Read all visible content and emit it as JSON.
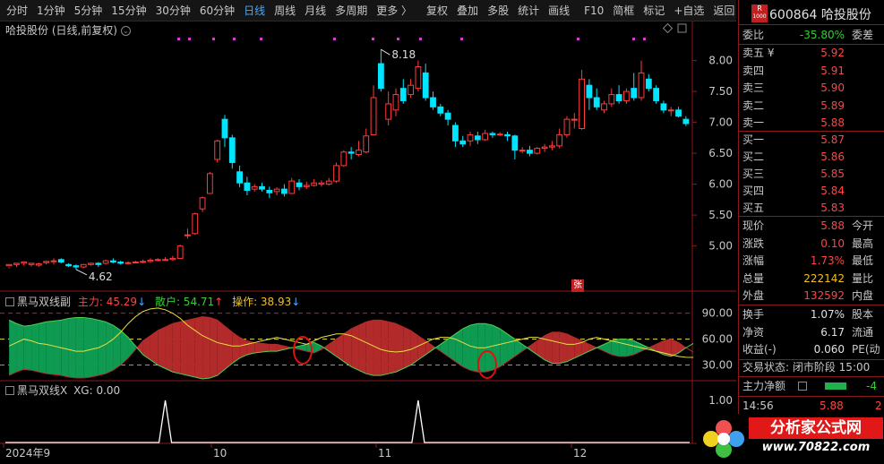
{
  "toolbar": {
    "items": [
      "分时",
      "1分钟",
      "5分钟",
      "15分钟",
      "30分钟",
      "60分钟",
      "日线",
      "周线",
      "月线",
      "多周期",
      "更多 〉",
      "复权",
      "叠加",
      "多股",
      "统计",
      "画线",
      "F10",
      "简框",
      "标记",
      "+自选",
      "返回"
    ],
    "active": "日线"
  },
  "chart": {
    "title": "哈投股份 (日线,前复权)",
    "high_label": "8.18",
    "low_label": "4.62",
    "price_ticks": [
      "8.00",
      "7.50",
      "7.00",
      "6.50",
      "6.00",
      "5.50",
      "5.00"
    ],
    "x_labels": [
      "2024年9",
      "10",
      "11",
      "12"
    ],
    "badge": "张"
  },
  "indicator1": {
    "name": "黑马双线副",
    "main_label": "主力: 45.29",
    "main_arrow": "↓",
    "retail_label": "散户: 54.71",
    "retail_arrow": "↑",
    "op_label": "操作: 38.93",
    "op_arrow": "↓",
    "ticks": [
      "90.00",
      "60.00",
      "30.00"
    ]
  },
  "indicator2": {
    "name": "黑马双线X",
    "xg_label": "XG: 0.00",
    "ticks": [
      "1.00",
      "0.50"
    ]
  },
  "quote": {
    "code": "600864",
    "name": "哈投股份",
    "r_badge": "R",
    "r_sub": "1000",
    "webi_label": "委比",
    "webi_value": "-35.80%",
    "weicha_label": "委差",
    "asks": [
      {
        "label": "卖五 ¥",
        "price": "5.92"
      },
      {
        "label": "卖四",
        "price": "5.91"
      },
      {
        "label": "卖三",
        "price": "5.90"
      },
      {
        "label": "卖二",
        "price": "5.89"
      },
      {
        "label": "卖一",
        "price": "5.88"
      }
    ],
    "bids": [
      {
        "label": "买一",
        "price": "5.87"
      },
      {
        "label": "买二",
        "price": "5.86"
      },
      {
        "label": "买三",
        "price": "5.85"
      },
      {
        "label": "买四",
        "price": "5.84"
      },
      {
        "label": "买五",
        "price": "5.83"
      }
    ],
    "stats": [
      {
        "label": "现价",
        "value": "5.88",
        "color": "red",
        "ext": "今开"
      },
      {
        "label": "涨跌",
        "value": "0.10",
        "color": "red",
        "ext": "最高"
      },
      {
        "label": "涨幅",
        "value": "1.73%",
        "color": "red",
        "ext": "最低"
      },
      {
        "label": "总量",
        "value": "222142",
        "color": "yellow",
        "ext": "量比"
      },
      {
        "label": "外盘",
        "value": "132592",
        "color": "red",
        "ext": "内盘"
      },
      {
        "label": "换手",
        "value": "1.07%",
        "color": "white",
        "ext": "股本"
      },
      {
        "label": "净资",
        "value": "6.17",
        "color": "white",
        "ext": "流通"
      },
      {
        "label": "收益(-)",
        "value": "0.060",
        "color": "white",
        "ext": "PE(动"
      }
    ],
    "trade_status": "交易状态: 闭市阶段 15:00",
    "net_label": "主力净额",
    "net_value": "-4",
    "time": "14:56",
    "tick_price": "5.88",
    "tick_vol": "2"
  },
  "logo": {
    "name": "分析家公式网",
    "url": "www.70822.com"
  },
  "colors": {
    "up": "#ff3c3c",
    "down": "#00e5ff",
    "main_fill": "#b22a2a",
    "retail_fill": "#0f9a52",
    "yellow_line": "#e8e040",
    "green_line": "#50d050",
    "circle": "#e01010"
  },
  "chart_data": {
    "type": "candlestick",
    "y_range": [
      4.4,
      8.4
    ],
    "candles": [
      [
        4.68,
        4.7,
        4.66,
        4.64
      ],
      [
        4.7,
        4.72,
        4.7,
        4.66
      ],
      [
        4.72,
        4.74,
        4.72,
        4.68
      ],
      [
        4.7,
        4.72,
        4.71,
        4.67
      ],
      [
        4.69,
        4.71,
        4.73,
        4.66
      ],
      [
        4.73,
        4.75,
        4.76,
        4.7
      ],
      [
        4.75,
        4.76,
        4.8,
        4.7
      ],
      [
        4.78,
        4.74,
        4.8,
        4.72
      ],
      [
        4.7,
        4.68,
        4.72,
        4.66
      ],
      [
        4.68,
        4.66,
        4.7,
        4.62
      ],
      [
        4.66,
        4.7,
        4.71,
        4.64
      ],
      [
        4.7,
        4.72,
        4.73,
        4.68
      ],
      [
        4.72,
        4.7,
        4.74,
        4.66
      ],
      [
        4.72,
        4.76,
        4.78,
        4.7
      ],
      [
        4.76,
        4.74,
        4.8,
        4.72
      ],
      [
        4.74,
        4.72,
        4.76,
        4.7
      ],
      [
        4.72,
        4.73,
        4.75,
        4.7
      ],
      [
        4.73,
        4.74,
        4.76,
        4.72
      ],
      [
        4.74,
        4.75,
        4.78,
        4.72
      ],
      [
        4.75,
        4.77,
        4.8,
        4.73
      ],
      [
        4.77,
        4.78,
        4.8,
        4.75
      ],
      [
        4.78,
        4.78,
        4.82,
        4.76
      ],
      [
        4.78,
        4.8,
        4.84,
        4.76
      ],
      [
        4.8,
        5.0,
        5.02,
        4.8
      ],
      [
        5.18,
        5.18,
        5.28,
        5.12
      ],
      [
        5.2,
        5.52,
        5.54,
        5.18
      ],
      [
        5.6,
        5.78,
        5.8,
        5.55
      ],
      [
        5.85,
        6.17,
        6.2,
        5.85
      ],
      [
        6.4,
        6.7,
        6.72,
        6.35
      ],
      [
        7.05,
        6.75,
        7.12,
        6.6
      ],
      [
        6.75,
        6.35,
        6.8,
        6.25
      ],
      [
        6.2,
        6.02,
        6.3,
        5.95
      ],
      [
        6.02,
        5.9,
        6.12,
        5.82
      ],
      [
        5.92,
        5.96,
        6.0,
        5.88
      ],
      [
        5.96,
        5.92,
        6.02,
        5.88
      ],
      [
        5.9,
        5.86,
        5.96,
        5.78
      ],
      [
        5.88,
        5.92,
        5.95,
        5.82
      ],
      [
        5.92,
        5.85,
        6.0,
        5.8
      ],
      [
        5.85,
        6.05,
        6.1,
        5.84
      ],
      [
        6.02,
        5.96,
        6.08,
        5.9
      ],
      [
        5.96,
        5.98,
        6.04,
        5.92
      ],
      [
        5.98,
        6.02,
        6.08,
        5.96
      ],
      [
        6.0,
        6.02,
        6.06,
        5.96
      ],
      [
        6.0,
        6.05,
        6.1,
        5.98
      ],
      [
        6.05,
        6.3,
        6.35,
        6.02
      ],
      [
        6.3,
        6.52,
        6.55,
        6.28
      ],
      [
        6.52,
        6.5,
        6.6,
        6.4
      ],
      [
        6.48,
        6.55,
        6.7,
        6.45
      ],
      [
        6.52,
        6.78,
        6.9,
        6.5
      ],
      [
        6.8,
        7.4,
        7.6,
        6.8
      ],
      [
        7.95,
        7.55,
        8.18,
        7.5
      ],
      [
        7.05,
        7.3,
        7.5,
        6.95
      ],
      [
        7.2,
        7.45,
        7.55,
        7.1
      ],
      [
        7.55,
        7.35,
        7.7,
        7.3
      ],
      [
        7.45,
        7.6,
        7.7,
        7.4
      ],
      [
        7.55,
        7.9,
        8.0,
        7.5
      ],
      [
        7.8,
        7.4,
        7.95,
        7.35
      ],
      [
        7.4,
        7.25,
        7.5,
        7.2
      ],
      [
        7.25,
        7.15,
        7.3,
        7.1
      ],
      [
        7.15,
        7.05,
        7.2,
        6.95
      ],
      [
        6.95,
        6.7,
        7.0,
        6.6
      ],
      [
        6.7,
        6.65,
        6.78,
        6.6
      ],
      [
        6.7,
        6.8,
        6.85,
        6.62
      ],
      [
        6.78,
        6.72,
        6.85,
        6.65
      ],
      [
        6.72,
        6.82,
        6.88,
        6.7
      ],
      [
        6.82,
        6.8,
        6.85,
        6.75
      ],
      [
        6.8,
        6.81,
        6.84,
        6.78
      ],
      [
        6.8,
        6.78,
        6.85,
        6.7
      ],
      [
        6.78,
        6.55,
        6.8,
        6.4
      ],
      [
        6.55,
        6.55,
        6.6,
        6.5
      ],
      [
        6.55,
        6.5,
        6.62,
        6.45
      ],
      [
        6.5,
        6.58,
        6.6,
        6.48
      ],
      [
        6.58,
        6.6,
        6.65,
        6.52
      ],
      [
        6.6,
        6.62,
        6.7,
        6.55
      ],
      [
        6.62,
        6.8,
        6.9,
        6.58
      ],
      [
        6.8,
        7.05,
        7.1,
        6.75
      ],
      [
        7.05,
        7.05,
        7.15,
        6.9
      ],
      [
        6.9,
        7.7,
        7.85,
        6.88
      ],
      [
        7.6,
        7.4,
        7.7,
        7.2
      ],
      [
        7.4,
        7.25,
        7.55,
        7.2
      ],
      [
        7.2,
        7.3,
        7.35,
        7.15
      ],
      [
        7.3,
        7.45,
        7.55,
        7.25
      ],
      [
        7.45,
        7.35,
        7.6,
        7.3
      ],
      [
        7.35,
        7.5,
        7.55,
        7.3
      ],
      [
        7.55,
        7.4,
        7.8,
        7.35
      ],
      [
        7.4,
        7.8,
        8.0,
        7.35
      ],
      [
        7.7,
        7.55,
        7.78,
        7.5
      ],
      [
        7.55,
        7.35,
        7.6,
        7.3
      ],
      [
        7.3,
        7.2,
        7.35,
        7.15
      ],
      [
        7.2,
        7.2,
        7.25,
        7.1
      ],
      [
        7.2,
        7.1,
        7.25,
        7.08
      ],
      [
        7.05,
        6.98,
        7.1,
        6.94
      ]
    ],
    "indicator_main": [
      18,
      22,
      25,
      24,
      22,
      20,
      19,
      18,
      16,
      15,
      15,
      16,
      18,
      20,
      24,
      30,
      38,
      48,
      58,
      64,
      70,
      74,
      78,
      80,
      82,
      84,
      86,
      85,
      82,
      75,
      68,
      62,
      58,
      56,
      55,
      54,
      54,
      52,
      50,
      48,
      46,
      44,
      48,
      54,
      60,
      66,
      72,
      76,
      80,
      82,
      82,
      80,
      78,
      74,
      70,
      64,
      58,
      52,
      46,
      40,
      34,
      28,
      24,
      22,
      22,
      24,
      28,
      34,
      40,
      46,
      52,
      58,
      64,
      68,
      68,
      66,
      62,
      58,
      54,
      50,
      46,
      42,
      40,
      40,
      42,
      46,
      50,
      54,
      58,
      60,
      56,
      50,
      45
    ],
    "indicator_retail": [
      82,
      78,
      75,
      76,
      78,
      80,
      81,
      82,
      84,
      85,
      85,
      84,
      82,
      80,
      76,
      70,
      62,
      52,
      42,
      36,
      30,
      26,
      22,
      20,
      18,
      16,
      14,
      15,
      18,
      25,
      32,
      38,
      42,
      44,
      45,
      46,
      46,
      48,
      50,
      52,
      54,
      56,
      52,
      46,
      40,
      34,
      28,
      24,
      20,
      18,
      18,
      20,
      22,
      26,
      30,
      36,
      42,
      48,
      54,
      60,
      66,
      72,
      76,
      78,
      78,
      76,
      72,
      66,
      60,
      54,
      48,
      42,
      36,
      32,
      32,
      34,
      38,
      42,
      46,
      50,
      54,
      58,
      60,
      60,
      58,
      54,
      50,
      46,
      42,
      40,
      44,
      50,
      55
    ],
    "indicator_op": [
      52,
      56,
      60,
      58,
      55,
      54,
      52,
      50,
      48,
      46,
      46,
      48,
      50,
      54,
      60,
      68,
      78,
      86,
      92,
      95,
      96,
      94,
      90,
      84,
      76,
      70,
      64,
      60,
      56,
      54,
      52,
      52,
      54,
      56,
      58,
      60,
      62,
      60,
      58,
      56,
      54,
      58,
      62,
      64,
      66,
      66,
      64,
      60,
      56,
      52,
      48,
      46,
      45,
      46,
      48,
      52,
      56,
      60,
      62,
      62,
      60,
      56,
      52,
      50,
      50,
      52,
      54,
      56,
      58,
      60,
      62,
      62,
      60,
      58,
      56,
      54,
      54,
      56,
      60,
      62,
      60,
      58,
      56,
      54,
      52,
      50,
      48,
      46,
      44,
      42,
      40,
      39,
      38.9
    ],
    "xg_signals": [
      {
        "index": 21,
        "value": 1
      },
      {
        "index": 55,
        "value": 1
      }
    ]
  }
}
